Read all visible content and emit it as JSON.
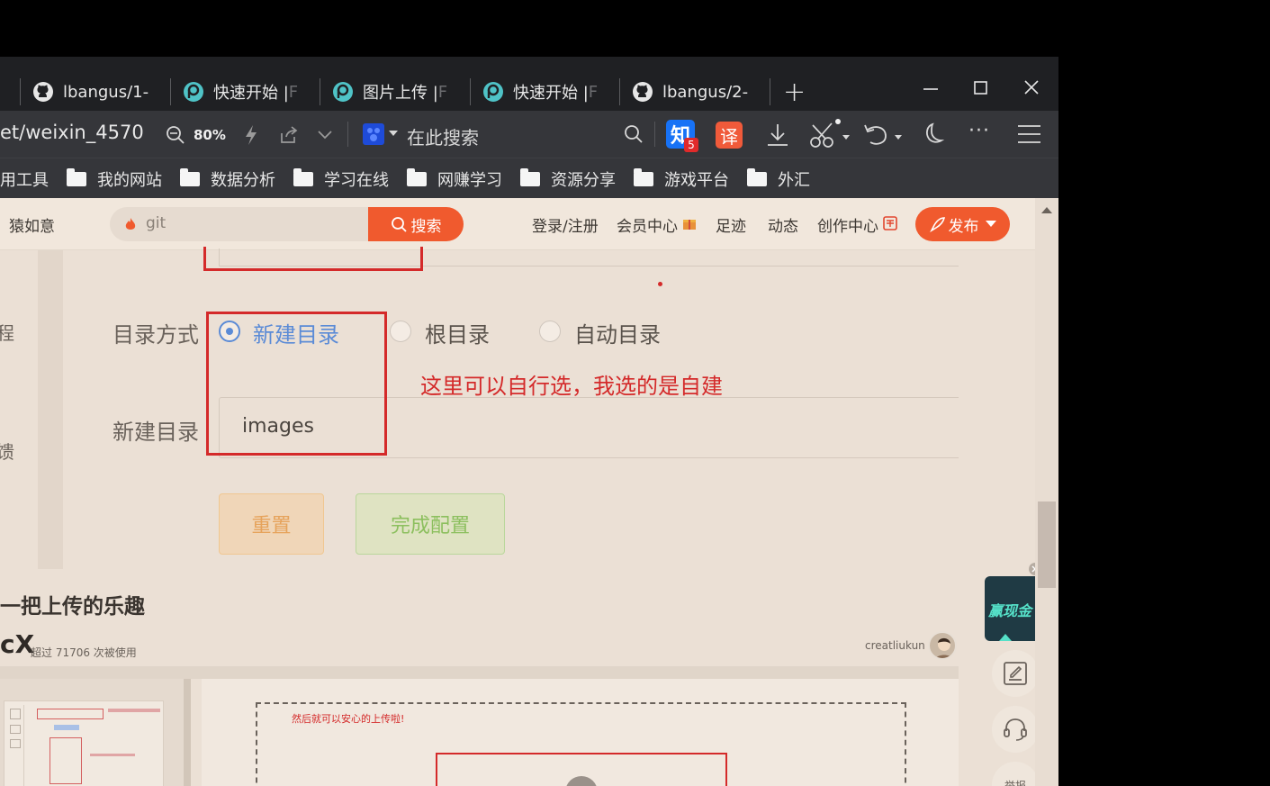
{
  "tabs": [
    {
      "label": "lbangus/1-",
      "icon": "github-icon"
    },
    {
      "label": "快速开始 | ",
      "faded": "F",
      "icon": "picgo-icon"
    },
    {
      "label": "图片上传 | ",
      "faded": "F",
      "icon": "picgo-icon"
    },
    {
      "label": "快速开始 | ",
      "faded": "F",
      "icon": "picgo-icon"
    },
    {
      "label": "lbangus/2-",
      "icon": "github-icon"
    }
  ],
  "new_tab": "+",
  "toolbar": {
    "url": "et/weixin_4570",
    "zoom": "80%",
    "search_placeholder": "在此搜索",
    "zhihu_badge": "5",
    "zhihu_label": "知",
    "translate_label": "译",
    "more": "···"
  },
  "bookmarks": [
    "用工具",
    "我的网站",
    "数据分析",
    "学习在线",
    "网赚学习",
    "资源分享",
    "游戏平台",
    "外汇"
  ],
  "site_header": {
    "left_text": "猿如意",
    "search_value": "git",
    "search_button": "搜索",
    "nav": [
      "登录/注册",
      "会员中心",
      "足迹",
      "动态",
      "创作中心"
    ],
    "publish": "发布"
  },
  "form": {
    "partial_left_1": "程",
    "partial_left_2": "馈",
    "dir_mode_label": "目录方式",
    "options": [
      "新建目录",
      "根目录",
      "自动目录"
    ],
    "selected_option": "新建目录",
    "annotation": "这里可以自行选，我选的是自建",
    "new_dir_label": "新建目录",
    "new_dir_value": "images",
    "reset_button": "重置",
    "finish_button": "完成配置"
  },
  "article": {
    "heading": "一把上传的乐趣",
    "product_partial": "cX",
    "usage": "超过 71706 次被使用",
    "author": "creatliukun",
    "preview_caption": "然后就可以安心的上传啦!"
  },
  "float": {
    "ad_text": "赢现金",
    "report": "举报"
  },
  "colors": {
    "accent_red": "#d42a2a",
    "publish_orange": "#f05a2e",
    "radio_blue": "#5b8bd6"
  }
}
